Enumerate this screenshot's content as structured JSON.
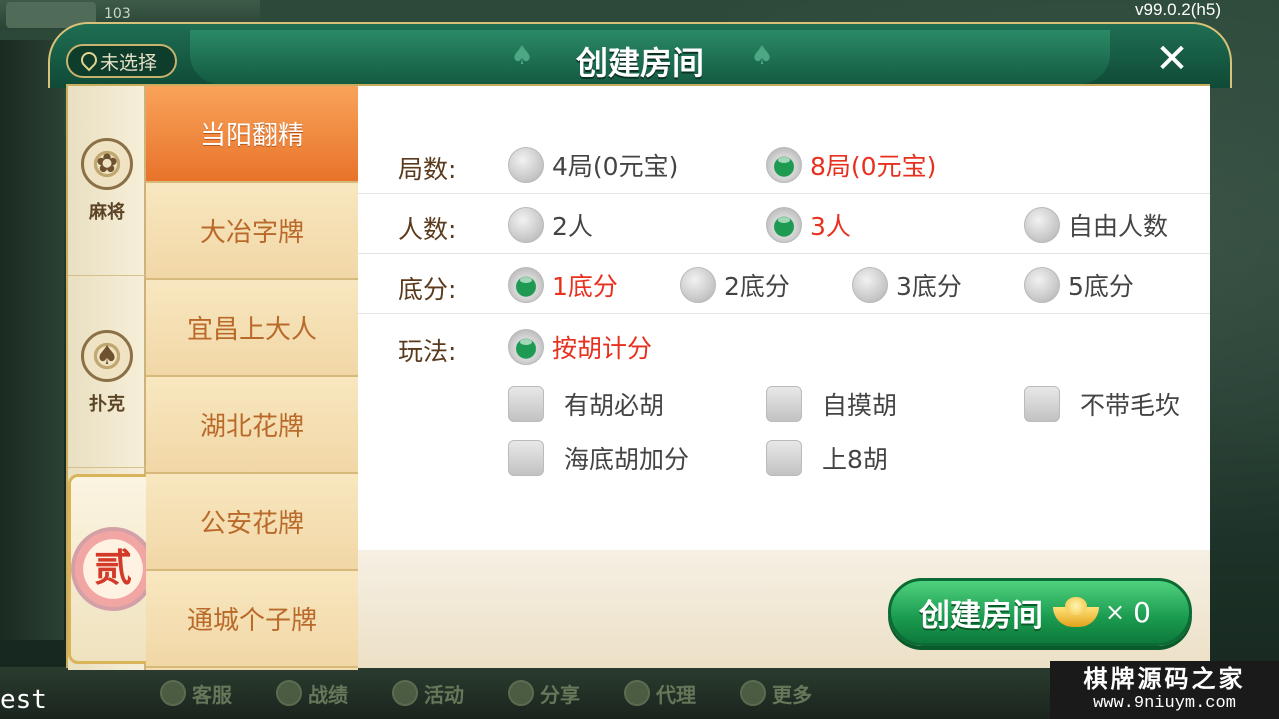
{
  "version": "v99.0.2(h5)",
  "top_strip": {
    "coins": "103"
  },
  "dialog": {
    "title": "创建房间",
    "location_label": "未选择",
    "close_glyph": "✕"
  },
  "categories": [
    {
      "label": "麻将",
      "icon": "mahjong-flower-icon",
      "glyph": "✿"
    },
    {
      "label": "扑克",
      "icon": "spade-icon",
      "glyph": "♠"
    },
    {
      "label": "",
      "icon": "er-badge-icon",
      "glyph": "贰"
    }
  ],
  "games": [
    {
      "label": "当阳翻精",
      "active": true
    },
    {
      "label": "大冶字牌",
      "active": false
    },
    {
      "label": "宜昌上大人",
      "active": false
    },
    {
      "label": "湖北花牌",
      "active": false
    },
    {
      "label": "公安花牌",
      "active": false
    },
    {
      "label": "通城个子牌",
      "active": false
    }
  ],
  "options": {
    "rounds": {
      "label": "局数:",
      "choices": [
        "4局(0元宝)",
        "8局(0元宝)"
      ],
      "selected": 1
    },
    "players": {
      "label": "人数:",
      "choices": [
        "2人",
        "3人",
        "自由人数"
      ],
      "selected": 1
    },
    "base_score": {
      "label": "底分:",
      "choices": [
        "1底分",
        "2底分",
        "3底分",
        "5底分"
      ],
      "selected": 0
    },
    "play_mode": {
      "label": "玩法:",
      "radio_label": "按胡计分",
      "checkboxes": [
        "有胡必胡",
        "自摸胡",
        "不带毛坎",
        "海底胡加分",
        "上8胡"
      ]
    }
  },
  "create_button": {
    "label": "创建房间",
    "multiplier": "×",
    "count": "0"
  },
  "bottom_nav": [
    "客服",
    "战绩",
    "活动",
    "分享",
    "代理",
    "更多"
  ],
  "test_text": "est",
  "watermark": {
    "line1": "棋牌源码之家",
    "line2": "www.9niuym.com"
  },
  "colors": {
    "accent_green": "#1a9a4f",
    "selected_red": "#e8301e",
    "active_tab_orange": "#e8732a"
  }
}
